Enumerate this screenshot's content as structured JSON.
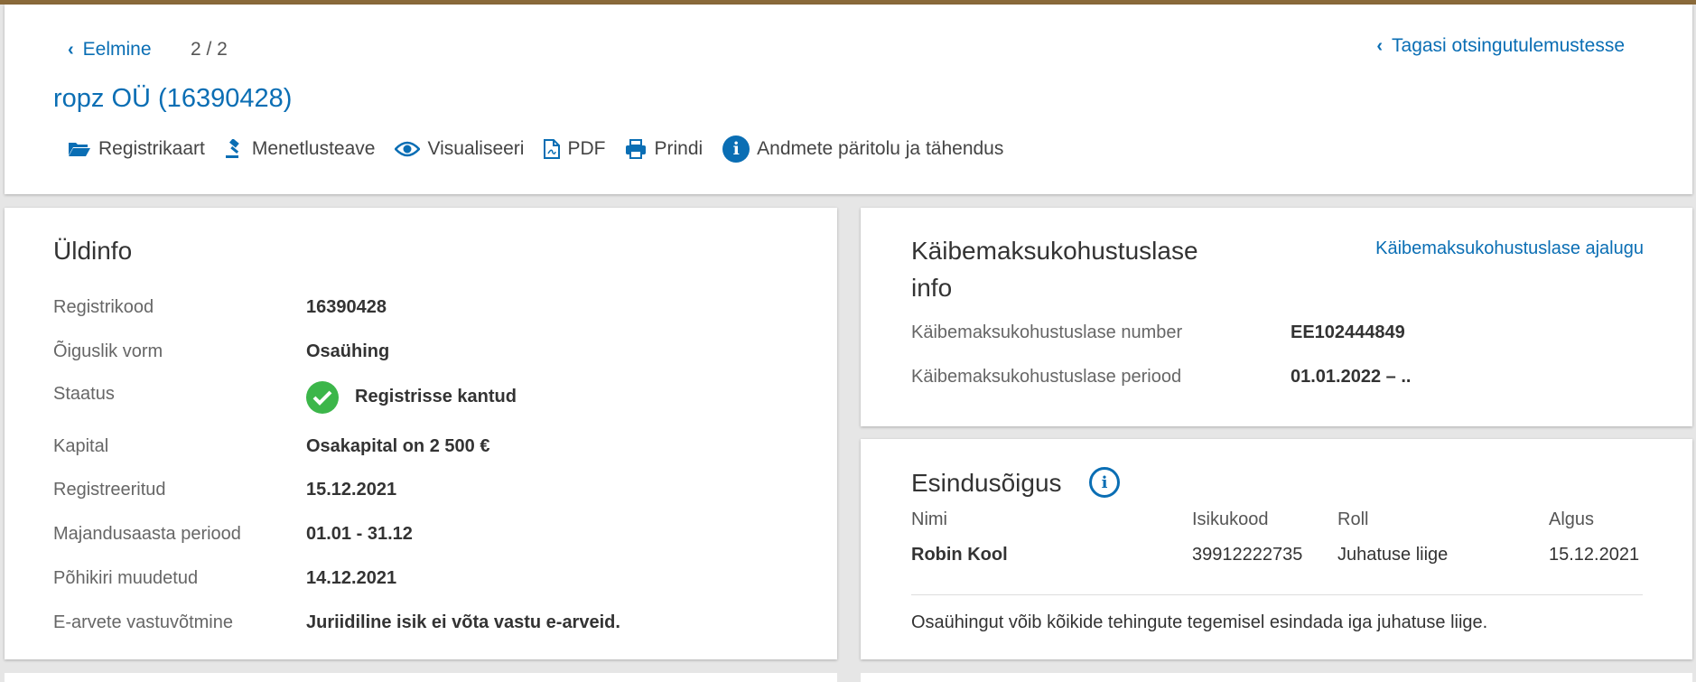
{
  "nav": {
    "prev_label": "Eelmine",
    "pager": "2 / 2",
    "back_label": "Tagasi otsingutulemustesse"
  },
  "company": {
    "title": "ropz OÜ (16390428)"
  },
  "toolbar": {
    "items": [
      {
        "label": "Registrikaart",
        "icon": "folder-open-icon"
      },
      {
        "label": "Menetlusteave",
        "icon": "gavel-icon"
      },
      {
        "label": "Visualiseeri",
        "icon": "eye-icon"
      },
      {
        "label": "PDF",
        "icon": "pdf-icon"
      },
      {
        "label": "Prindi",
        "icon": "print-icon"
      },
      {
        "label": "Andmete päritolu ja tähendus",
        "icon": "info-icon"
      }
    ]
  },
  "general": {
    "title": "Üldinfo",
    "rows": [
      {
        "label": "Registrikood",
        "value": "16390428"
      },
      {
        "label": "Õiguslik vorm",
        "value": "Osaühing"
      },
      {
        "label": "Staatus",
        "value": "Registrisse kantud"
      },
      {
        "label": "Kapital",
        "value": "Osakapital on 2 500 €"
      },
      {
        "label": "Registreeritud",
        "value": "15.12.2021"
      },
      {
        "label": "Majandusaasta periood",
        "value": "01.01 - 31.12"
      },
      {
        "label": "Põhikiri muudetud",
        "value": "14.12.2021"
      },
      {
        "label": "E-arvete vastuvõtmine",
        "value": "Juriidiline isik ei võta vastu e-arveid."
      }
    ]
  },
  "vat": {
    "title_line1": "Käibemaksukohustuslase",
    "title_line2": "info",
    "history_link": "Käibemaksukohustuslase ajalugu",
    "rows": [
      {
        "label": "Käibemaksukohustuslase number",
        "value": "EE102444849"
      },
      {
        "label": "Käibemaksukohustuslase periood",
        "value": "01.01.2022 – .."
      }
    ]
  },
  "representation": {
    "title": "Esindusõigus",
    "columns": [
      "Nimi",
      "Isikukood",
      "Roll",
      "Algus"
    ],
    "rows": [
      {
        "name": "Robin Kool",
        "code": "39912222735",
        "role": "Juhatuse liige",
        "start": "15.12.2021"
      }
    ],
    "note": "Osaühingut võib kõikide tehingute tegemisel esindada iga juhatuse liige."
  },
  "colors": {
    "accent": "#0a6eb4",
    "status_ok": "#3cb64a"
  }
}
